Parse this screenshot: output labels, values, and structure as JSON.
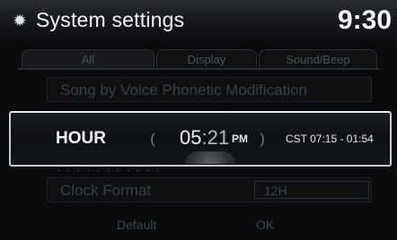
{
  "header": {
    "title": "System settings",
    "clock": "9:30",
    "settings_icon": "gear-icon"
  },
  "tabs": [
    {
      "label": "All"
    },
    {
      "label": "Display"
    },
    {
      "label": "Sound/Beep"
    }
  ],
  "list": {
    "row1": {
      "label": "Song by Voice Phonetic Modification"
    },
    "row2": {
      "label": "Clock Format",
      "value": "12H"
    }
  },
  "popup": {
    "field_label": "HOUR",
    "hour": "05",
    "minute": ":21",
    "ampm": "PM",
    "timezone_range": "CST 07:15 - 01:54",
    "left_arrow": "(",
    "right_arrow": ")"
  },
  "footer": {
    "default_label": "Default",
    "ok_label": "OK"
  },
  "colors": {
    "popup_border": "#c9cdd1",
    "text": "#f1f3f5",
    "dim_text": "#3a3f45"
  }
}
